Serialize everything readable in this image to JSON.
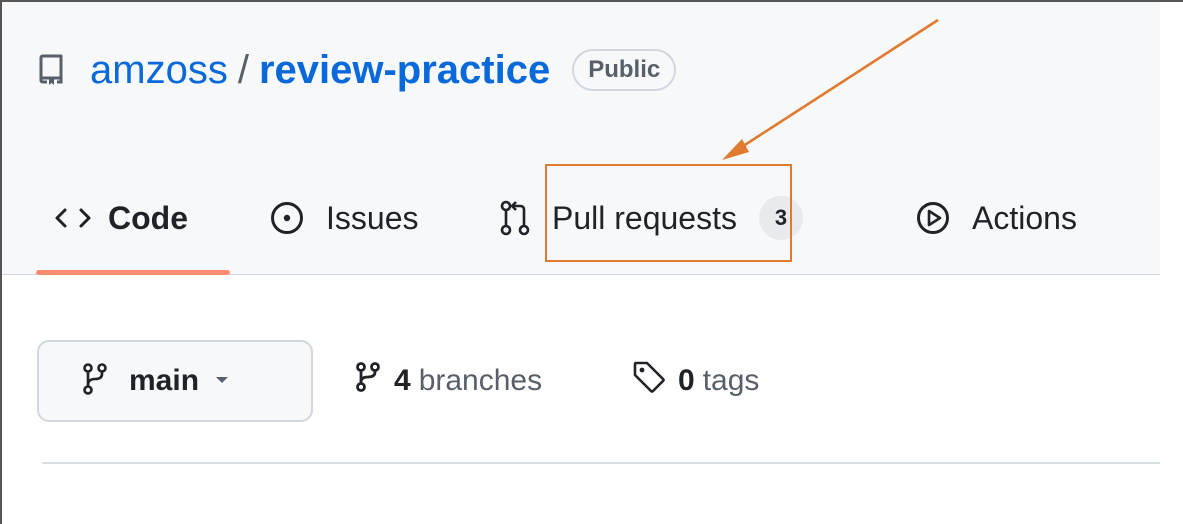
{
  "repo": {
    "owner": "amzoss",
    "separator": "/",
    "name": "review-practice",
    "visibility": "Public",
    "icon": "repo-icon"
  },
  "tabs": [
    {
      "label": "Code",
      "icon": "code-icon",
      "selected": true
    },
    {
      "label": "Issues",
      "icon": "issue-opened-icon"
    },
    {
      "label": "Pull requests",
      "icon": "git-pull-request-icon",
      "count": "3"
    },
    {
      "label": "Actions",
      "icon": "play-icon"
    }
  ],
  "branch_selector": {
    "label": "main",
    "icon": "git-branch-icon"
  },
  "stats": {
    "branches_count": "4",
    "branches_label": "branches",
    "tags_count": "0",
    "tags_label": "tags"
  },
  "annotation": {
    "color": "#e07a2e",
    "target": "Pull requests"
  },
  "colors": {
    "link": "#0969da",
    "tab_underline": "#fd8c73",
    "header_bg": "#f6f8fa"
  }
}
